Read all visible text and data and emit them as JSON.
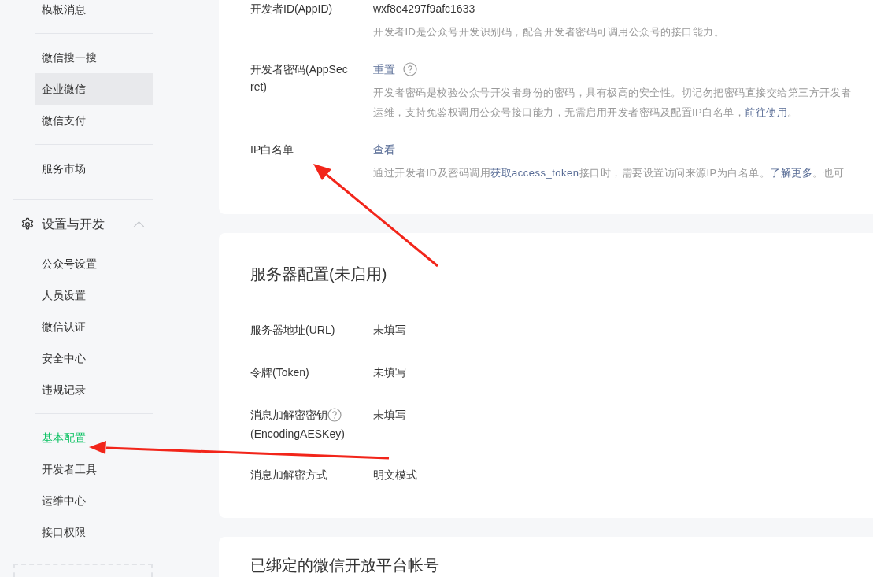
{
  "sidebar": {
    "items": [
      {
        "kind": "item",
        "label": "模板消息",
        "selected": false,
        "hovered": false
      },
      {
        "kind": "divider"
      },
      {
        "kind": "item",
        "label": "微信搜一搜",
        "selected": false,
        "hovered": false
      },
      {
        "kind": "item",
        "label": "企业微信",
        "selected": false,
        "hovered": true
      },
      {
        "kind": "item",
        "label": "微信支付",
        "selected": false,
        "hovered": false
      },
      {
        "kind": "divider"
      },
      {
        "kind": "item",
        "label": "服务市场",
        "selected": false,
        "hovered": false
      },
      {
        "kind": "section",
        "label": "设置与开发",
        "expanded": true
      },
      {
        "kind": "item",
        "label": "公众号设置",
        "selected": false,
        "hovered": false
      },
      {
        "kind": "item",
        "label": "人员设置",
        "selected": false,
        "hovered": false
      },
      {
        "kind": "item",
        "label": "微信认证",
        "selected": false,
        "hovered": false
      },
      {
        "kind": "item",
        "label": "安全中心",
        "selected": false,
        "hovered": false
      },
      {
        "kind": "item",
        "label": "违规记录",
        "selected": false,
        "hovered": false
      },
      {
        "kind": "divider"
      },
      {
        "kind": "item",
        "label": "基本配置",
        "selected": true,
        "hovered": false
      },
      {
        "kind": "item",
        "label": "开发者工具",
        "selected": false,
        "hovered": false
      },
      {
        "kind": "item",
        "label": "运维中心",
        "selected": false,
        "hovered": false
      },
      {
        "kind": "item",
        "label": "接口权限",
        "selected": false,
        "hovered": false
      }
    ]
  },
  "cards": [
    {
      "rows": [
        {
          "label": "开发者ID(AppID)",
          "value": "wxf8e4297f9afc1633",
          "value_link": false,
          "help": false,
          "description": [
            [
              {
                "text": "开发者ID是公众号开发识别码，配合开发者密码可调用公众号的接口能力。",
                "link": false
              }
            ]
          ]
        },
        {
          "label": "开发者密码(AppSecret)",
          "value": "重置",
          "value_link": true,
          "help": true,
          "description": [
            [
              {
                "text": "开发者密码是校验公众号开发者身份的密码，具有极高的安全性。切记勿把密码直接交给第三方开发者",
                "link": false
              }
            ],
            [
              {
                "text": "运维，支持免鉴权调用公众号接口能力，无需启用开发者密码及配置IP白名单，",
                "link": false
              },
              {
                "text": "前往使用",
                "link": true
              },
              {
                "text": "。",
                "link": false
              }
            ]
          ]
        },
        {
          "label": "IP白名单",
          "value": "查看",
          "value_link": true,
          "help": false,
          "description": [
            [
              {
                "text": "通过开发者ID及密码调用",
                "link": false
              },
              {
                "text": "获取access_token",
                "link": true
              },
              {
                "text": "接口时，需要设置访问来源IP为白名单。",
                "link": false
              },
              {
                "text": "了解更多",
                "link": true
              },
              {
                "text": "。也可",
                "link": false
              }
            ]
          ]
        }
      ]
    },
    {
      "title": "服务器配置(未启用)",
      "rows": [
        {
          "label": "服务器地址(URL)",
          "value": "未填写",
          "value_link": false,
          "label_help": false
        },
        {
          "label": "令牌(Token)",
          "value": "未填写",
          "value_link": false,
          "label_help": false
        },
        {
          "label": "消息加解密密钥",
          "label_note": "(EncodingAESKey)",
          "value": "未填写",
          "value_link": false,
          "label_help": true
        },
        {
          "label": "消息加解密方式",
          "value": "明文模式",
          "value_link": false,
          "label_help": false
        }
      ]
    },
    {
      "title": "已绑定的微信开放平台帐号"
    }
  ]
}
